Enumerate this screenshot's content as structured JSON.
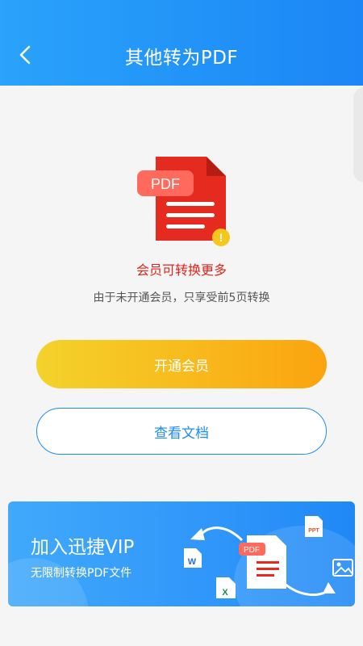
{
  "header": {
    "title": "其他转为PDF",
    "back_icon": "chevron-left-icon"
  },
  "pdf_icon": {
    "label": "PDF",
    "badge": "!",
    "red": "#e52b1f",
    "badge_color": "#f5c61c"
  },
  "notice": {
    "title": "会员可转换更多",
    "subtitle": "由于未开通会员，只享受前5页转换"
  },
  "buttons": {
    "vip": "开通会员",
    "view": "查看文档"
  },
  "banner": {
    "title": "加入迅捷VIP",
    "subtitle": "无限制转换PDF文件",
    "pdf_label": "PDF",
    "ppt_label": "PPT",
    "word_label": "W",
    "excel_label": "X"
  },
  "colors": {
    "primary": "#1d8cf3",
    "accent_red": "#e5231a",
    "vip_gold": "#f8b91c"
  }
}
